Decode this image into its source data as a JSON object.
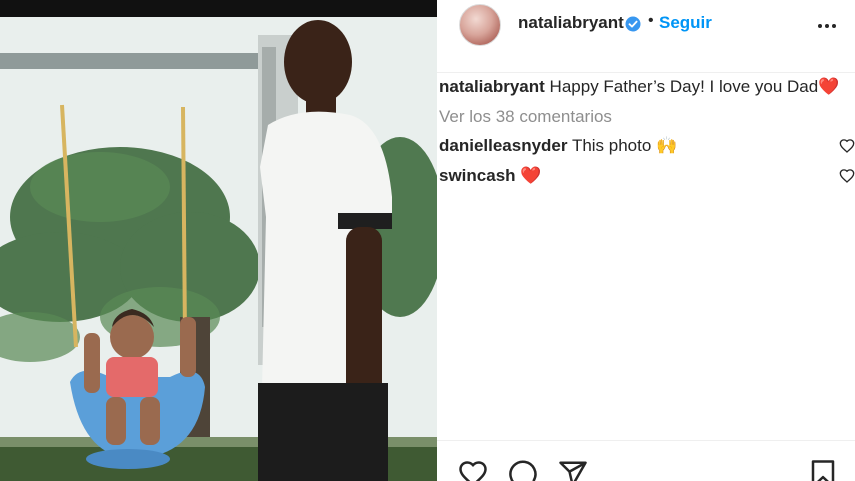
{
  "post": {
    "username": "nataliabryant",
    "separator": "•",
    "follow_label": "Seguir",
    "caption_user": "nataliabryant",
    "caption_text": "Happy Father’s Day! I love you Dad",
    "caption_emoji": "❤️",
    "view_comments": "Ver los 38 comentarios",
    "comments": [
      {
        "user": "danielleasnyder",
        "text": "This photo",
        "emoji": "🙌"
      },
      {
        "user": "swincash",
        "text": "",
        "emoji": "❤️"
      }
    ]
  },
  "icons": {
    "verified": "verified-badge-icon",
    "more": "more-options-icon",
    "like": "heart-icon",
    "comment": "comment-icon",
    "share": "share-icon",
    "save": "bookmark-icon"
  },
  "colors": {
    "link_blue": "#0095f6",
    "verified_blue": "#3897f0",
    "heart_red": "#e0211f",
    "muted_text": "#8e8e8e"
  }
}
